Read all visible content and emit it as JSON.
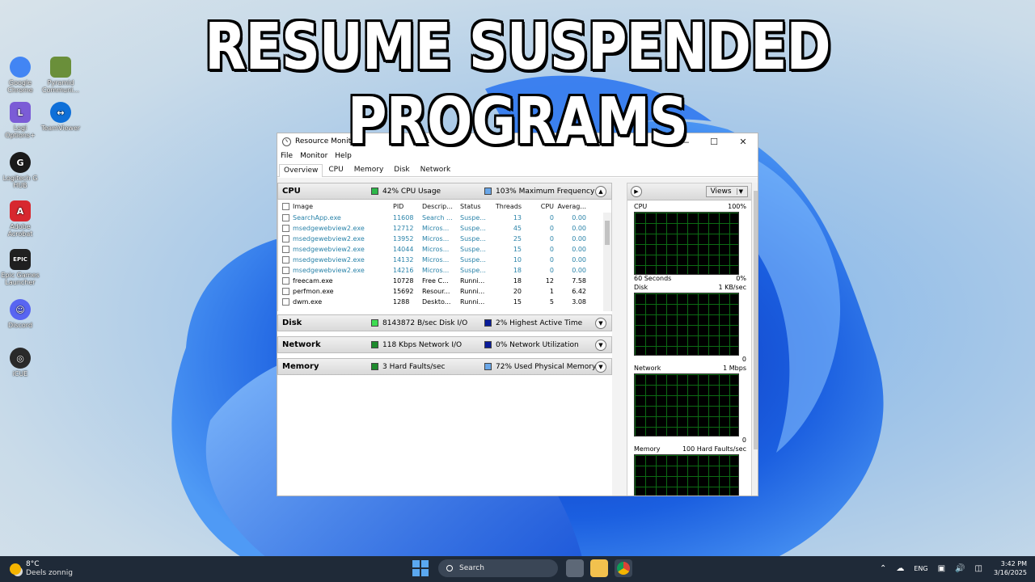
{
  "headline": "RESUME SUSPENDED PROGRAMS",
  "desktop_icons": [
    {
      "label": "Google Chrome",
      "glyph": "",
      "color": "#4285f4"
    },
    {
      "label": "Pyramid Communi...",
      "glyph": "",
      "color": "#6a8f3a"
    },
    {
      "label": "Logi Options+",
      "glyph": "L",
      "color": "#7b5cd6"
    },
    {
      "label": "TeamViewer",
      "glyph": "↔",
      "color": "#0e6fd8"
    },
    {
      "label": "Logitech G HUB",
      "glyph": "G",
      "color": "#1a1a1a"
    },
    {
      "label": "Adobe Acrobat",
      "glyph": "A",
      "color": "#d7282f"
    },
    {
      "label": "Epic Games Launcher",
      "glyph": "EPIC",
      "color": "#202020"
    },
    {
      "label": "Discord",
      "glyph": "☺",
      "color": "#5865f2"
    },
    {
      "label": "iCUE",
      "glyph": "◎",
      "color": "#2a2a2a"
    }
  ],
  "window": {
    "title": "Resource Monitor",
    "menu": [
      "File",
      "Monitor",
      "Help"
    ],
    "tabs": [
      "Overview",
      "CPU",
      "Memory",
      "Disk",
      "Network"
    ],
    "active_tab": "Overview"
  },
  "cpu": {
    "name": "CPU",
    "stat1": "42% CPU Usage",
    "stat2": "103% Maximum Frequency",
    "columns": [
      "Image",
      "PID",
      "Descrip...",
      "Status",
      "Threads",
      "CPU",
      "Averag..."
    ],
    "rows": [
      {
        "image": "SearchApp.exe",
        "pid": "11608",
        "desc": "Search ...",
        "status": "Suspe...",
        "threads": "13",
        "cpu": "0",
        "avg": "0.00",
        "suspended": true
      },
      {
        "image": "msedgewebview2.exe",
        "pid": "12712",
        "desc": "Micros...",
        "status": "Suspe...",
        "threads": "45",
        "cpu": "0",
        "avg": "0.00",
        "suspended": true
      },
      {
        "image": "msedgewebview2.exe",
        "pid": "13952",
        "desc": "Micros...",
        "status": "Suspe...",
        "threads": "25",
        "cpu": "0",
        "avg": "0.00",
        "suspended": true
      },
      {
        "image": "msedgewebview2.exe",
        "pid": "14044",
        "desc": "Micros...",
        "status": "Suspe...",
        "threads": "15",
        "cpu": "0",
        "avg": "0.00",
        "suspended": true
      },
      {
        "image": "msedgewebview2.exe",
        "pid": "14132",
        "desc": "Micros...",
        "status": "Suspe...",
        "threads": "10",
        "cpu": "0",
        "avg": "0.00",
        "suspended": true
      },
      {
        "image": "msedgewebview2.exe",
        "pid": "14216",
        "desc": "Micros...",
        "status": "Suspe...",
        "threads": "18",
        "cpu": "0",
        "avg": "0.00",
        "suspended": true
      },
      {
        "image": "freecam.exe",
        "pid": "10728",
        "desc": "Free C...",
        "status": "Runni...",
        "threads": "18",
        "cpu": "12",
        "avg": "7.58",
        "suspended": false
      },
      {
        "image": "perfmon.exe",
        "pid": "15692",
        "desc": "Resour...",
        "status": "Runni...",
        "threads": "20",
        "cpu": "1",
        "avg": "6.42",
        "suspended": false
      },
      {
        "image": "dwm.exe",
        "pid": "1288",
        "desc": "Deskto...",
        "status": "Runni...",
        "threads": "15",
        "cpu": "5",
        "avg": "3.08",
        "suspended": false
      }
    ]
  },
  "disk": {
    "name": "Disk",
    "stat1": "8143872 B/sec Disk I/O",
    "stat2": "2% Highest Active Time"
  },
  "network": {
    "name": "Network",
    "stat1": "118 Kbps Network I/O",
    "stat2": "0% Network Utilization"
  },
  "memory": {
    "name": "Memory",
    "stat1": "3 Hard Faults/sec",
    "stat2": "72% Used Physical Memory"
  },
  "right_pane": {
    "views_label": "Views",
    "graphs": [
      {
        "name": "CPU",
        "max": "100%",
        "foot_left": "60 Seconds",
        "foot_right": "0%"
      },
      {
        "name": "Disk",
        "max": "1 KB/sec",
        "foot_left": "",
        "foot_right": "0"
      },
      {
        "name": "Network",
        "max": "1 Mbps",
        "foot_left": "",
        "foot_right": "0"
      },
      {
        "name": "Memory",
        "max": "100 Hard Faults/sec",
        "foot_left": "",
        "foot_right": ""
      }
    ]
  },
  "colors": {
    "cpu_usage": "#2db84a",
    "max_freq": "#6aa7e8",
    "disk_io": "#3ddc52",
    "net_io": "#1d8a2c",
    "mem_faults": "#1d8a2c",
    "dark_blue": "#0a1c9a",
    "used_mem": "#6aa7e8"
  },
  "taskbar": {
    "temp": "8°C",
    "weather": "Deels zonnig",
    "search_placeholder": "Search",
    "lang": "ENG",
    "time": "3:42 PM",
    "date": "3/16/2025"
  }
}
